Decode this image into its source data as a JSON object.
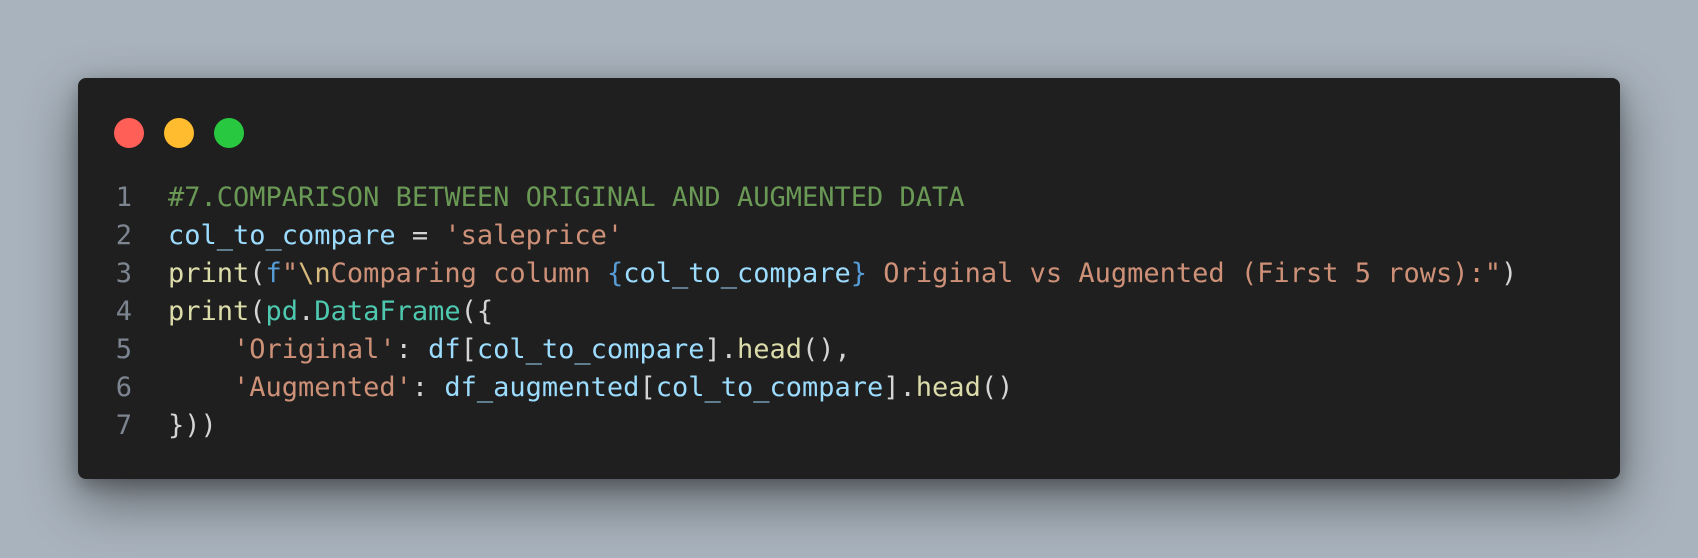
{
  "window": {
    "controls": [
      "close",
      "minimize",
      "maximize"
    ]
  },
  "colors": {
    "background": "#a9b3bd",
    "editor": "#1f1f1f",
    "close": "#ff5f57",
    "minimize": "#febc2e",
    "maximize": "#28c840",
    "comment": "#6a9955",
    "variable": "#9cdcfe",
    "string": "#ce9178",
    "function": "#dcdcaa",
    "keyword": "#569cd6",
    "class": "#4ec9b0",
    "plain": "#d4d4d4"
  },
  "code": {
    "lines": [
      {
        "number": "1",
        "tokens": [
          {
            "text": "#7.COMPARISON BETWEEN ORIGINAL AND AUGMENTED DATA",
            "kind": "comment"
          }
        ]
      },
      {
        "number": "2",
        "tokens": [
          {
            "text": "col_to_compare",
            "kind": "var"
          },
          {
            "text": " = ",
            "kind": "plain"
          },
          {
            "text": "'saleprice'",
            "kind": "string"
          }
        ]
      },
      {
        "number": "3",
        "tokens": [
          {
            "text": "print",
            "kind": "func"
          },
          {
            "text": "(",
            "kind": "plain"
          },
          {
            "text": "f",
            "kind": "keyword"
          },
          {
            "text": "\"",
            "kind": "string"
          },
          {
            "text": "\\n",
            "kind": "escape"
          },
          {
            "text": "Comparing column ",
            "kind": "string"
          },
          {
            "text": "{",
            "kind": "keyword"
          },
          {
            "text": "col_to_compare",
            "kind": "var"
          },
          {
            "text": "}",
            "kind": "keyword"
          },
          {
            "text": " Original vs Augmented (First 5 rows):\"",
            "kind": "string"
          },
          {
            "text": ")",
            "kind": "plain"
          }
        ]
      },
      {
        "number": "4",
        "tokens": [
          {
            "text": "print",
            "kind": "func"
          },
          {
            "text": "(",
            "kind": "plain"
          },
          {
            "text": "pd",
            "kind": "class"
          },
          {
            "text": ".",
            "kind": "plain"
          },
          {
            "text": "DataFrame",
            "kind": "class"
          },
          {
            "text": "({",
            "kind": "plain"
          }
        ]
      },
      {
        "number": "5",
        "tokens": [
          {
            "text": "    ",
            "kind": "plain"
          },
          {
            "text": "'Original'",
            "kind": "string"
          },
          {
            "text": ": ",
            "kind": "plain"
          },
          {
            "text": "df",
            "kind": "var"
          },
          {
            "text": "[",
            "kind": "plain"
          },
          {
            "text": "col_to_compare",
            "kind": "var"
          },
          {
            "text": "].",
            "kind": "plain"
          },
          {
            "text": "head",
            "kind": "func"
          },
          {
            "text": "(),",
            "kind": "plain"
          }
        ]
      },
      {
        "number": "6",
        "tokens": [
          {
            "text": "    ",
            "kind": "plain"
          },
          {
            "text": "'Augmented'",
            "kind": "string"
          },
          {
            "text": ": ",
            "kind": "plain"
          },
          {
            "text": "df_augmented",
            "kind": "var"
          },
          {
            "text": "[",
            "kind": "plain"
          },
          {
            "text": "col_to_compare",
            "kind": "var"
          },
          {
            "text": "].",
            "kind": "plain"
          },
          {
            "text": "head",
            "kind": "func"
          },
          {
            "text": "()",
            "kind": "plain"
          }
        ]
      },
      {
        "number": "7",
        "tokens": [
          {
            "text": "}))",
            "kind": "plain"
          }
        ]
      }
    ]
  }
}
